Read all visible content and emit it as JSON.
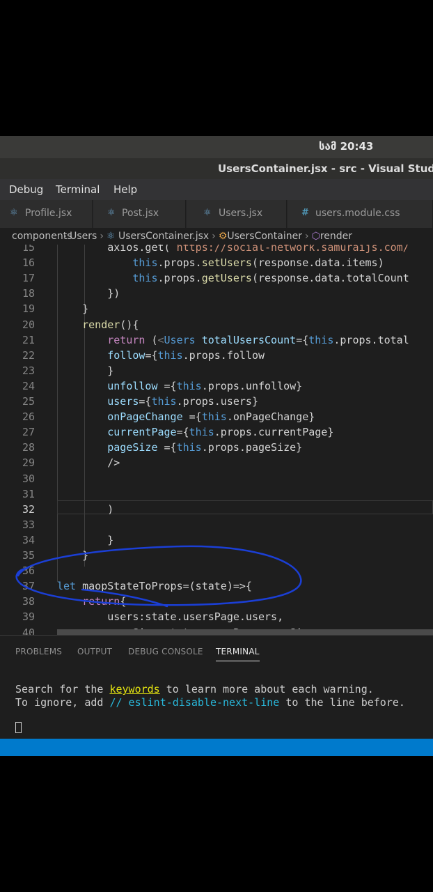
{
  "system": {
    "clock": "სამ 20:43"
  },
  "window": {
    "title": "UsersContainer.jsx - src - Visual Studio"
  },
  "menu": {
    "items": [
      "Debug",
      "Terminal",
      "Help"
    ]
  },
  "tabs": [
    {
      "label": "Profile.jsx",
      "icon": "react-icon"
    },
    {
      "label": "Post.jsx",
      "icon": "react-icon"
    },
    {
      "label": "Users.jsx",
      "icon": "react-icon"
    },
    {
      "label": "users.module.css",
      "icon": "hash-icon"
    }
  ],
  "breadcrumb": {
    "items": [
      "components",
      "Users",
      "UsersContainer.jsx",
      "UsersContainer",
      "render"
    ]
  },
  "editor": {
    "lines": [
      {
        "n": "15",
        "text": "        axios.get( https://social-network.samuraijs.com/"
      },
      {
        "n": "16",
        "text": "            this.props.setUsers(response.data.items)"
      },
      {
        "n": "17",
        "text": "            this.props.getUsers(response.data.totalCount"
      },
      {
        "n": "18",
        "text": "        })"
      },
      {
        "n": "19",
        "text": "    }"
      },
      {
        "n": "20",
        "text": "    render(){"
      },
      {
        "n": "21",
        "text": "        return (<Users totalUsersCount={this.props.total"
      },
      {
        "n": "22",
        "text": "        follow={this.props.follow"
      },
      {
        "n": "23",
        "text": "        }"
      },
      {
        "n": "24",
        "text": "        unfollow ={this.props.unfollow}"
      },
      {
        "n": "25",
        "text": "        users={this.props.users}"
      },
      {
        "n": "26",
        "text": "        onPageChange ={this.onPageChange}"
      },
      {
        "n": "27",
        "text": "        currentPage={this.props.currentPage}"
      },
      {
        "n": "28",
        "text": "        pageSize ={this.props.pageSize}"
      },
      {
        "n": "29",
        "text": "        />"
      },
      {
        "n": "30",
        "text": ""
      },
      {
        "n": "31",
        "text": ""
      },
      {
        "n": "32",
        "text": "        )"
      },
      {
        "n": "33",
        "text": ""
      },
      {
        "n": "34",
        "text": "        }"
      },
      {
        "n": "35",
        "text": "    }"
      },
      {
        "n": "36",
        "text": ""
      },
      {
        "n": "37",
        "text": "let maopStateToProps=(state)=>{"
      },
      {
        "n": "38",
        "text": "    return{"
      },
      {
        "n": "39",
        "text": "        users:state.usersPage.users,"
      },
      {
        "n": "40",
        "text": "        pageSize:state.usersPage.pageSize,"
      }
    ]
  },
  "panel": {
    "tabs": [
      "PROBLEMS",
      "OUTPUT",
      "DEBUG CONSOLE",
      "TERMINAL"
    ],
    "active_tab": "TERMINAL",
    "terminal": {
      "line1_pre": "Search for the ",
      "line1_keyword": "keywords",
      "line1_post": " to learn more about each warning.",
      "line2_pre": "To ignore, add ",
      "line2_comment": "// eslint-disable-next-line",
      "line2_post": " to the line before."
    }
  },
  "colors": {
    "editor_bg": "#1e1e1e",
    "statusbar": "#007acc",
    "annotation_ink": "#1b3fd6"
  }
}
